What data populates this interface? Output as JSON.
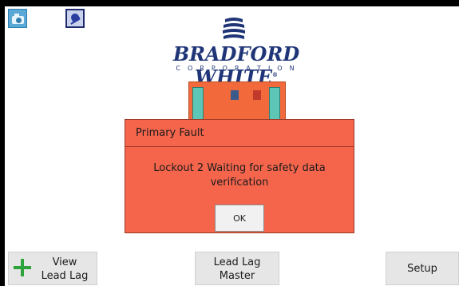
{
  "toolbar": {
    "camera_icon": "camera-icon",
    "bell_icon": "bell-icon"
  },
  "logo": {
    "name": "BRADFORD WHITE",
    "registered": "®",
    "sub": "CORPORATION"
  },
  "dialog": {
    "title": "Primary Fault",
    "message": "Lockout 2 Waiting for safety data verification",
    "ok_label": "OK"
  },
  "bottom": {
    "view_line1": "View",
    "view_line2": "Lead Lag",
    "master_line1": "Lead Lag",
    "master_line2": "Master",
    "setup_label": "Setup"
  },
  "colors": {
    "dialog_bg": "#f4654c",
    "brand_blue": "#1f3577",
    "plus_green": "#2fa33b"
  }
}
